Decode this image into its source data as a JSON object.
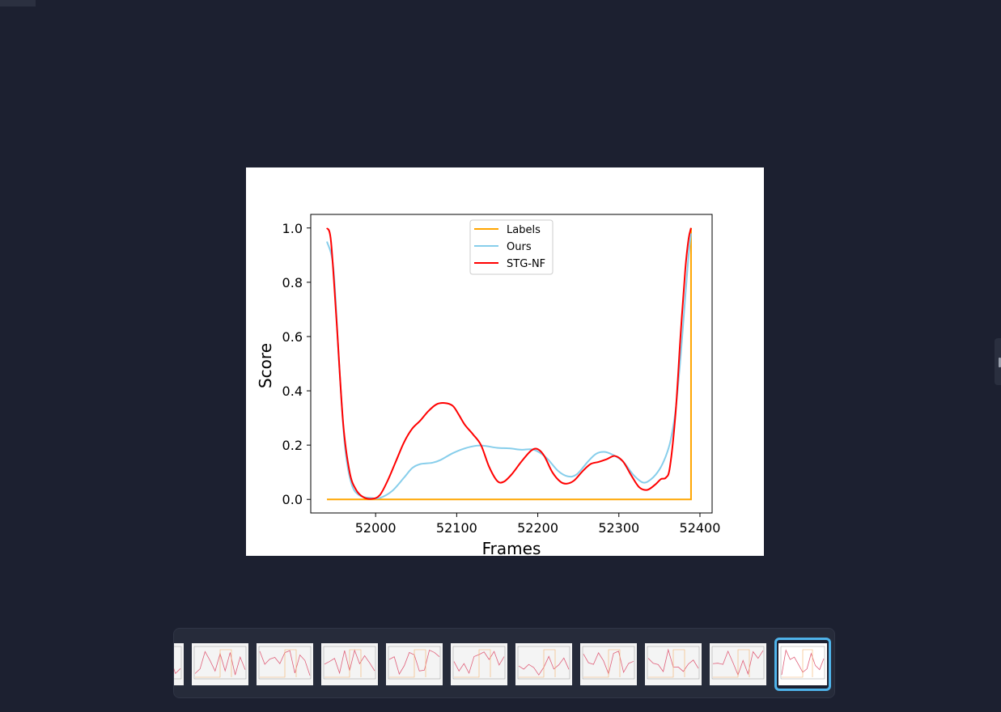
{
  "viewer": {
    "image_alt": "Score vs Frames plot"
  },
  "chart_data": {
    "type": "line",
    "title": "",
    "xlabel": "Frames",
    "ylabel": "Score",
    "xlim": [
      51920,
      52415
    ],
    "ylim": [
      -0.05,
      1.05
    ],
    "xticks": [
      52000,
      52100,
      52200,
      52300,
      52400
    ],
    "yticks": [
      0.0,
      0.2,
      0.4,
      0.6,
      0.8,
      1.0
    ],
    "xtick_labels": [
      "52000",
      "52100",
      "52200",
      "52300",
      "52400"
    ],
    "ytick_labels": [
      "0.0",
      "0.2",
      "0.4",
      "0.6",
      "0.8",
      "1.0"
    ],
    "legend_position": "top-center",
    "grid": false,
    "series": [
      {
        "name": "Labels",
        "color": "#FFA500",
        "points": [
          [
            51940,
            0.0
          ],
          [
            52389,
            0.0
          ],
          [
            52389,
            1.0
          ]
        ]
      },
      {
        "name": "Ours",
        "color": "#87CEEB",
        "points": [
          [
            51940,
            0.95
          ],
          [
            51948,
            0.85
          ],
          [
            51955,
            0.5
          ],
          [
            51962,
            0.2
          ],
          [
            51970,
            0.06
          ],
          [
            51980,
            0.015
          ],
          [
            51995,
            0.005
          ],
          [
            52005,
            0.005
          ],
          [
            52020,
            0.03
          ],
          [
            52035,
            0.08
          ],
          [
            52045,
            0.115
          ],
          [
            52055,
            0.13
          ],
          [
            52070,
            0.135
          ],
          [
            52080,
            0.145
          ],
          [
            52095,
            0.17
          ],
          [
            52110,
            0.188
          ],
          [
            52125,
            0.198
          ],
          [
            52135,
            0.197
          ],
          [
            52150,
            0.19
          ],
          [
            52165,
            0.188
          ],
          [
            52180,
            0.183
          ],
          [
            52195,
            0.183
          ],
          [
            52210,
            0.155
          ],
          [
            52225,
            0.105
          ],
          [
            52237,
            0.085
          ],
          [
            52248,
            0.092
          ],
          [
            52262,
            0.14
          ],
          [
            52272,
            0.168
          ],
          [
            52282,
            0.175
          ],
          [
            52292,
            0.165
          ],
          [
            52305,
            0.14
          ],
          [
            52318,
            0.09
          ],
          [
            52330,
            0.062
          ],
          [
            52340,
            0.075
          ],
          [
            52350,
            0.11
          ],
          [
            52358,
            0.16
          ],
          [
            52364,
            0.22
          ],
          [
            52370,
            0.33
          ],
          [
            52376,
            0.52
          ],
          [
            52382,
            0.75
          ],
          [
            52386,
            0.9
          ],
          [
            52389,
            0.98
          ]
        ]
      },
      {
        "name": "STG-NF",
        "color": "#FF0000",
        "points": [
          [
            51940,
            1.0
          ],
          [
            51945,
            0.95
          ],
          [
            51952,
            0.65
          ],
          [
            51960,
            0.28
          ],
          [
            51968,
            0.1
          ],
          [
            51976,
            0.035
          ],
          [
            51985,
            0.008
          ],
          [
            51995,
            0.002
          ],
          [
            52005,
            0.015
          ],
          [
            52015,
            0.07
          ],
          [
            52025,
            0.14
          ],
          [
            52035,
            0.21
          ],
          [
            52045,
            0.26
          ],
          [
            52055,
            0.29
          ],
          [
            52065,
            0.325
          ],
          [
            52075,
            0.35
          ],
          [
            52085,
            0.355
          ],
          [
            52095,
            0.345
          ],
          [
            52102,
            0.315
          ],
          [
            52110,
            0.275
          ],
          [
            52120,
            0.24
          ],
          [
            52130,
            0.2
          ],
          [
            52140,
            0.12
          ],
          [
            52150,
            0.068
          ],
          [
            52158,
            0.065
          ],
          [
            52168,
            0.093
          ],
          [
            52180,
            0.14
          ],
          [
            52192,
            0.18
          ],
          [
            52200,
            0.185
          ],
          [
            52208,
            0.16
          ],
          [
            52218,
            0.1
          ],
          [
            52228,
            0.065
          ],
          [
            52236,
            0.058
          ],
          [
            52245,
            0.07
          ],
          [
            52255,
            0.103
          ],
          [
            52265,
            0.13
          ],
          [
            52275,
            0.138
          ],
          [
            52285,
            0.148
          ],
          [
            52295,
            0.16
          ],
          [
            52305,
            0.14
          ],
          [
            52315,
            0.09
          ],
          [
            52325,
            0.045
          ],
          [
            52335,
            0.035
          ],
          [
            52345,
            0.055
          ],
          [
            52352,
            0.075
          ],
          [
            52358,
            0.08
          ],
          [
            52363,
            0.12
          ],
          [
            52370,
            0.32
          ],
          [
            52376,
            0.6
          ],
          [
            52382,
            0.85
          ],
          [
            52386,
            0.96
          ],
          [
            52389,
            1.0
          ]
        ]
      }
    ]
  },
  "filmstrip": {
    "thumbnails": [
      {
        "id": "t0"
      },
      {
        "id": "t1"
      },
      {
        "id": "t2"
      },
      {
        "id": "t3"
      },
      {
        "id": "t4"
      },
      {
        "id": "t5"
      },
      {
        "id": "t6"
      },
      {
        "id": "t7"
      },
      {
        "id": "t8"
      },
      {
        "id": "t9"
      },
      {
        "id": "t10"
      }
    ],
    "active_index": 10,
    "active_color": "#4fb3ea"
  }
}
